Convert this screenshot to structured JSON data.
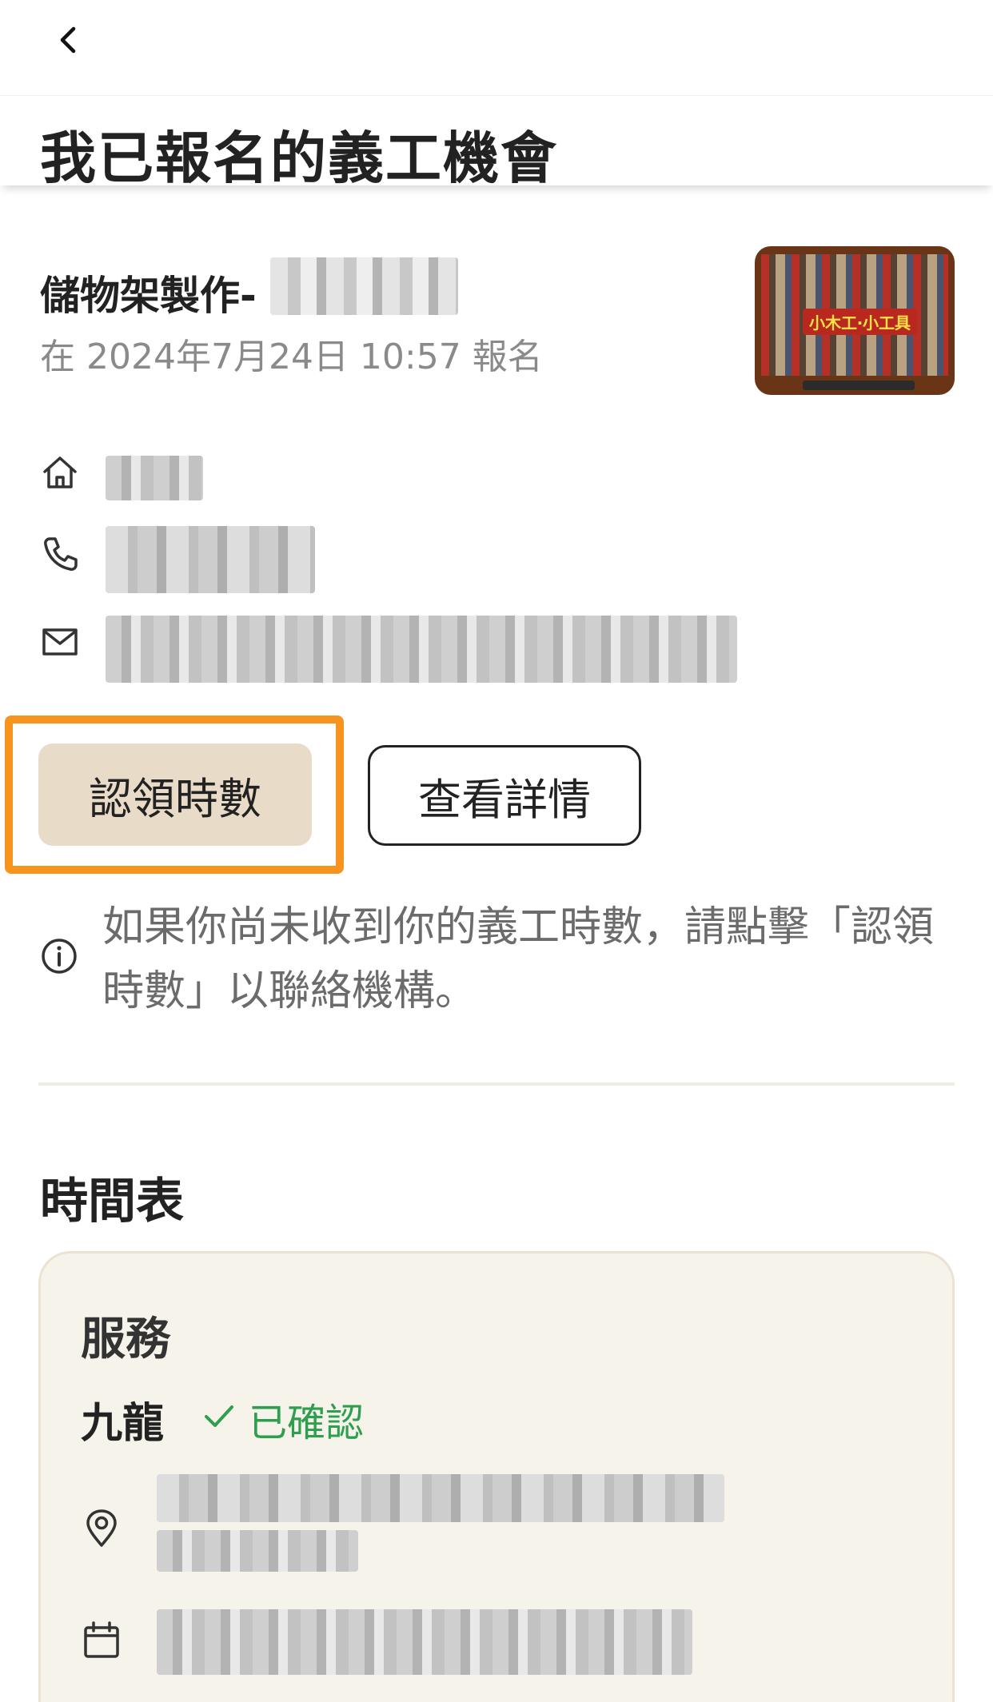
{
  "header": {
    "back_icon": "chevron-left-icon",
    "title": "我已報名的義工機會"
  },
  "event": {
    "name": "儲物架製作-",
    "registered_at": "在 2024年7月24日 10:57 報名",
    "thumbnail_label": "小木工‧小工具"
  },
  "contact": {
    "icons": [
      "home-icon",
      "phone-icon",
      "mail-icon"
    ]
  },
  "actions": {
    "claim_hours": "認領時數",
    "view_details": "查看詳情",
    "highlight_color": "#f7941d"
  },
  "info": {
    "text": "如果你尚未收到你的義工時數，請點擊「認領時數」以聯絡機構。"
  },
  "schedule": {
    "title": "時間表",
    "card": {
      "service_title": "服務",
      "region": "九龍",
      "status": "已確認",
      "status_color": "#2e9e4f",
      "location_icon": "location-pin-icon",
      "date_icon": "calendar-icon"
    }
  }
}
